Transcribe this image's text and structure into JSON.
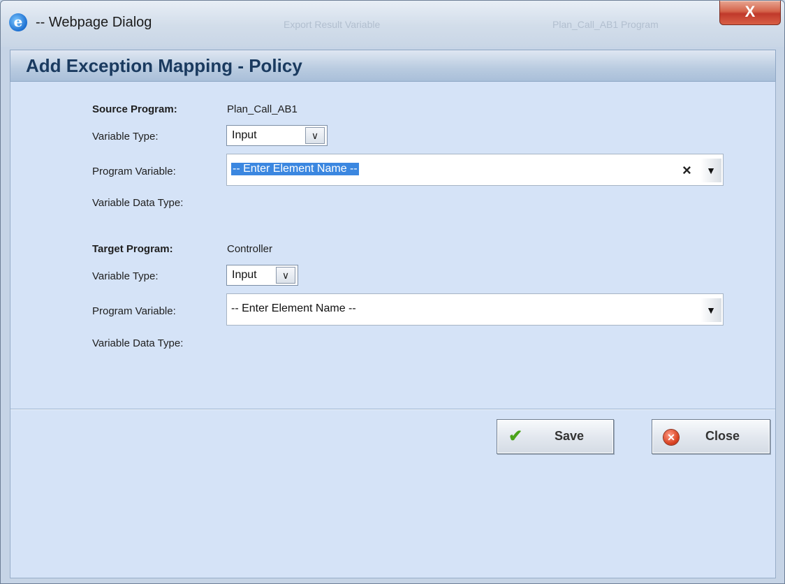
{
  "window": {
    "title": "-- Webpage Dialog",
    "icon": "ie-icon",
    "close_glyph": "X",
    "ghost_titles": [
      "Plan_Call_AB1 Program",
      "Export Result Variable"
    ]
  },
  "dialog": {
    "header": "Add Exception Mapping - Policy"
  },
  "source": {
    "program_label": "Source Program:",
    "program_value": "Plan_Call_AB1",
    "variable_type_label": "Variable Type:",
    "variable_type_value": "Input",
    "program_variable_label": "Program Variable:",
    "program_variable_value": "-- Enter Element Name --",
    "clear_glyph": "×",
    "data_type_label": "Variable Data Type:"
  },
  "target": {
    "program_label": "Target Program:",
    "program_value": "Controller",
    "variable_type_label": "Variable Type:",
    "variable_type_value": "Input",
    "program_variable_label": "Program Variable:",
    "program_variable_value": "-- Enter Element Name --",
    "data_type_label": "Variable Data Type:"
  },
  "buttons": {
    "save": "Save",
    "close": "Close"
  },
  "glyphs": {
    "dropdown": "∨",
    "combo_arrow": "▼",
    "check": "✔",
    "x_circle": "✕",
    "ie": "e"
  },
  "colors": {
    "content_bg": "#d5e3f7",
    "header_text": "#1a3a5f",
    "selection": "#3b87e0",
    "close_button": "#c0392b"
  }
}
